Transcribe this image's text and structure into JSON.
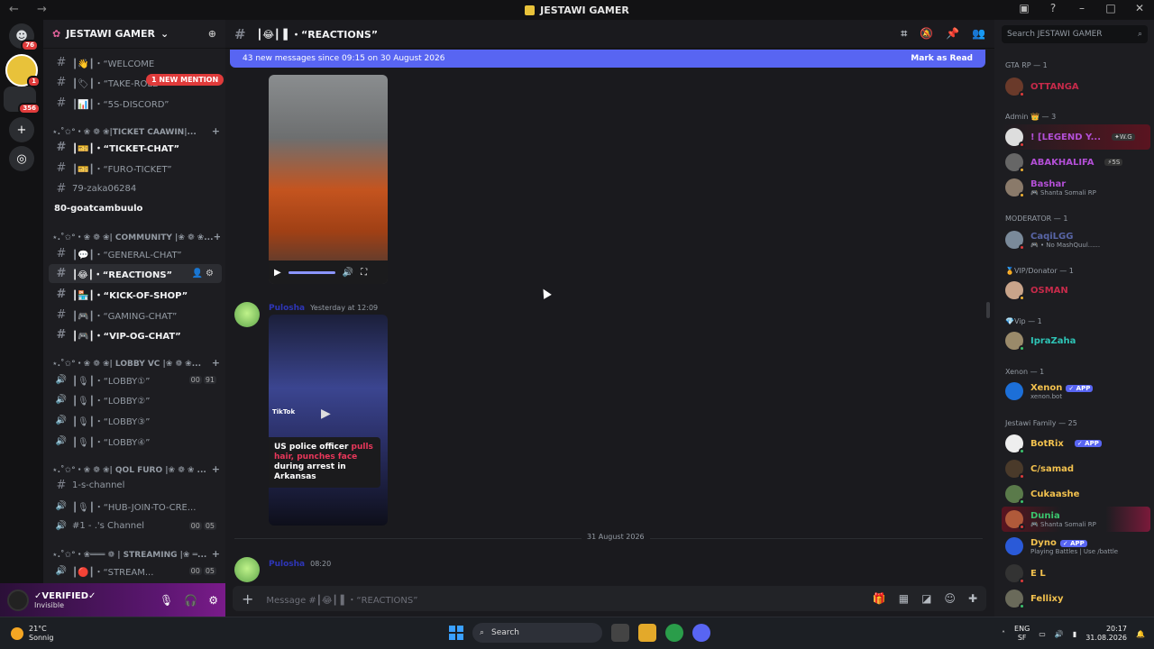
{
  "window": {
    "title": "JESTAWI GAMER"
  },
  "servers": [
    {
      "badge": "76"
    },
    {
      "badge": "1"
    },
    {
      "badge": "356"
    }
  ],
  "guild": {
    "name": "JESTAWI GAMER"
  },
  "channel_list": {
    "mention_pill": "1 NEW MENTION",
    "items": [
      {
        "label": "┃👋┃・“WELCOME",
        "kind": "text"
      },
      {
        "label": "┃🏷┃・“TAKE-ROLE”",
        "kind": "text"
      },
      {
        "label": "┃📊┃・“5S-DISCORD”",
        "kind": "text"
      },
      {
        "label": "⋆.˚✩°・❀ ❁ ❀|TICKET CAAWIN|...",
        "kind": "category"
      },
      {
        "label": "┃🎫┃・“TICKET-CHAT”",
        "kind": "text",
        "unread": true
      },
      {
        "label": "┃🎫┃・“FURO-TICKET”",
        "kind": "text"
      },
      {
        "label": "79-zaka06284",
        "kind": "text"
      },
      {
        "label": "80-goatcambuulo",
        "kind": "text",
        "unread": true
      },
      {
        "label": "⋆.˚✩°・❀ ❁ ❀| COMMUNITY |❀ ❁ ❀...",
        "kind": "category"
      },
      {
        "label": "┃💬┃・“GENERAL-CHAT”",
        "kind": "text"
      },
      {
        "label": "┃😂┃・“REACTIONS”",
        "kind": "text",
        "active": true
      },
      {
        "label": "┃🏪┃・“KICK-OF-SHOP”",
        "kind": "text",
        "unread": true
      },
      {
        "label": "┃🎮┃・“GAMING-CHAT”",
        "kind": "text"
      },
      {
        "label": "┃🎮┃・“VIP-OG-CHAT”",
        "kind": "text",
        "unread": true
      },
      {
        "label": "⋆.˚✩°・❀ ❁ ❀| LOBBY VC |❀ ❁ ❀...",
        "kind": "category"
      },
      {
        "label": "┃🎙┃・“LOBBY①”",
        "kind": "voice",
        "count_a": "00",
        "count_b": "91"
      },
      {
        "label": "┃🎙┃・“LOBBY②”",
        "kind": "voice"
      },
      {
        "label": "┃🎙┃・“LOBBY③”",
        "kind": "voice"
      },
      {
        "label": "┃🎙┃・“LOBBY④”",
        "kind": "voice"
      },
      {
        "label": "⋆.˚✩°・❀ ❁ ❀| QOL FURO |❀ ❁ ❀ ...",
        "kind": "category"
      },
      {
        "label": "1-s-channel",
        "kind": "text"
      },
      {
        "label": "┃🎙┃・“HUB-JOIN-TO-CRE...",
        "kind": "voice"
      },
      {
        "label": "#1 - .'s Channel",
        "kind": "voice",
        "count_a": "00",
        "count_b": "05"
      },
      {
        "label": "⋆.˚✩°・❀═══ ❁ | STREAMING |❀ ═...",
        "kind": "category"
      },
      {
        "label": "┃🔴┃・“STREAM...",
        "kind": "voice",
        "count_a": "00",
        "count_b": "05"
      }
    ]
  },
  "user": {
    "name": "✓VERIFIED✓",
    "status": "Invisible"
  },
  "chat": {
    "channel_title": "┃😂┃ ▌・“REACTIONS”",
    "new_messages": "43 new messages since 09:15 on 30 August 2026",
    "mark_as_read": "Mark as Read",
    "messages": [
      {
        "username": "Pulosha",
        "time": "Yesterday at 12:09"
      },
      {
        "username": "Pulosha",
        "time": "08:20"
      }
    ],
    "video2_watermark": "TikTok",
    "video2_caption_a": "US police officer",
    "video2_caption_b": "pulls hair, punches face",
    "video2_caption_c": "during arrest in Arkansas",
    "date_divider": "31 August 2026",
    "composer_placeholder": "Message #┃😂┃ ▌・“REACTIONS”"
  },
  "members": {
    "search_placeholder": "Search JESTAWI GAMER",
    "groups": [
      {
        "role": "GTA RP — 1"
      },
      {
        "role": "Admin 👑 — 3"
      },
      {
        "role": "MODERATOR — 1"
      },
      {
        "role": "🏅VIP/Donator — 1"
      },
      {
        "role": "💎Vip — 1"
      },
      {
        "role": "Xenon — 1"
      },
      {
        "role": "Jestawi Family — 25"
      }
    ],
    "list": [
      {
        "name": "OTTANGA",
        "color": "#c62a4a"
      },
      {
        "name": "! [LEGEND Y...",
        "color": "#b34fd6",
        "tag2": "✦W.G"
      },
      {
        "name": "ABAKHALIFA",
        "color": "#b34fd6",
        "tag2": "⚡5S"
      },
      {
        "name": "Bashar",
        "color": "#b34fd6",
        "sub": "🎮 Shanta Somali RP"
      },
      {
        "name": "CaqiLGG",
        "color": "#5865a6",
        "sub": "🎮 • No MashQuul......"
      },
      {
        "name": "OSMAN",
        "color": "#c62a4a"
      },
      {
        "name": "IpraZaha",
        "color": "#2ec4b6"
      },
      {
        "name": "Xenon",
        "color": "#f2c14e",
        "tag": "✓ APP",
        "sub": "xenon.bot"
      },
      {
        "name": "BotRix",
        "color": "#f2c14e",
        "tag": "✓ APP"
      },
      {
        "name": "C/samad",
        "color": "#f2c14e"
      },
      {
        "name": "Cukaashe",
        "color": "#f2c14e"
      },
      {
        "name": "Dunia",
        "color": "#3bc46d",
        "sub": "🎮 Shanta Somali RP"
      },
      {
        "name": "Dyno",
        "color": "#f2c14e",
        "tag": "✓ APP",
        "sub": "Playing Battles | Use /battle"
      },
      {
        "name": "E L",
        "color": "#f2c14e"
      },
      {
        "name": "Fellixy",
        "color": "#f2c14e"
      }
    ]
  },
  "taskbar": {
    "temp": "21°C",
    "weather": "Sonnig",
    "search": "Search",
    "lang_a": "ENG",
    "lang_b": "SF",
    "time": "20:17",
    "date": "31.08.2026"
  },
  "colors": {
    "accent": "#5865f2",
    "mention": "#e03b3b"
  }
}
